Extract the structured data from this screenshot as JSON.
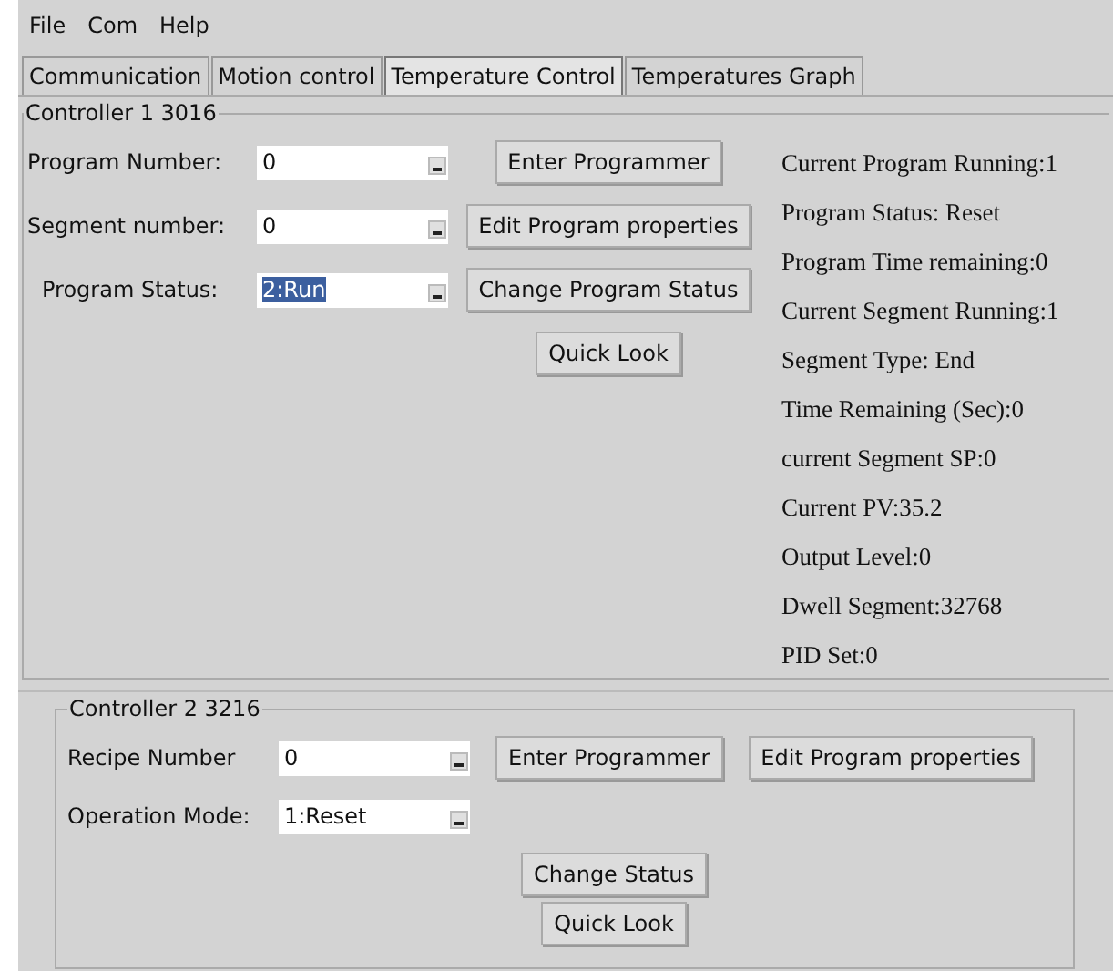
{
  "menu": [
    "File",
    "Com",
    "Help"
  ],
  "tabs": [
    {
      "label": "Communication",
      "selected": false
    },
    {
      "label": "Motion control",
      "selected": false
    },
    {
      "label": "Temperature Control",
      "selected": true
    },
    {
      "label": "Temperatures Graph",
      "selected": false
    }
  ],
  "controller_1": {
    "title": "Controller 1 3016",
    "fields": [
      {
        "label": "Program Number:",
        "value": "0",
        "text_selected": false
      },
      {
        "label": "Segment number:",
        "value": "0",
        "text_selected": false
      },
      {
        "label": "Program Status:",
        "value": "2:Run",
        "text_selected": true
      }
    ],
    "buttons": [
      "Enter Programmer",
      "Edit Program properties",
      "Change Program Status",
      "Quick Look"
    ],
    "status": [
      "Current Program Running:1",
      "Program Status: Reset",
      "Program Time remaining:0",
      "Current Segment Running:1",
      "Segment Type: End",
      "Time Remaining (Sec):0",
      "current Segment SP:0",
      "Current PV:35.2",
      "Output Level:0",
      "Dwell Segment:32768",
      "PID Set:0"
    ]
  },
  "controller_2": {
    "title": "Controller 2 3216",
    "fields": [
      {
        "label": "Recipe Number",
        "value": "0",
        "text_selected": false
      },
      {
        "label": "Operation Mode:",
        "value": "1:Reset",
        "text_selected": false
      }
    ],
    "buttons": [
      "Enter Programmer",
      "Edit Program properties",
      "Change Status",
      "Quick Look"
    ]
  }
}
